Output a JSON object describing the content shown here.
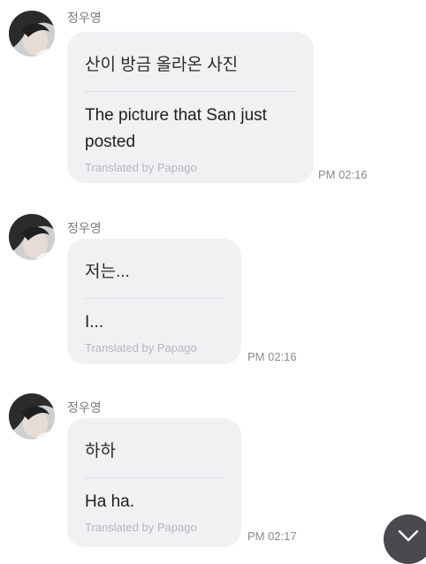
{
  "messages": [
    {
      "sender": "정우영",
      "original": "산이 방금 올라온 사진",
      "translation": "The picture that San just posted",
      "credit": "Translated by Papago",
      "time": "PM 02:16"
    },
    {
      "sender": "정우영",
      "original": "저는...",
      "translation": "I...",
      "credit": "Translated by Papago",
      "time": "PM 02:16"
    },
    {
      "sender": "정우영",
      "original": "하하",
      "translation": "Ha ha.",
      "credit": "Translated by Papago",
      "time": "PM 02:17"
    }
  ],
  "icons": {
    "avatar": "profile-photo",
    "scroll": "chevron-down-icon"
  },
  "colors": {
    "bubble": "#f1f1f4",
    "scroll_button": "#4a4a4e"
  }
}
